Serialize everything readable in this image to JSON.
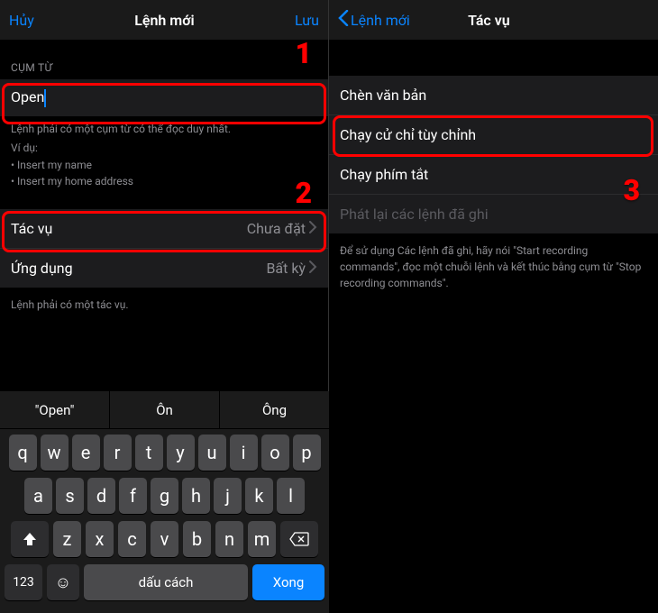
{
  "left": {
    "nav": {
      "cancel": "Hủy",
      "title": "Lệnh mới",
      "save": "Lưu"
    },
    "section_phrase": "CỤM TỪ",
    "input_value": "Open",
    "help_line": "Lệnh phải có một cụm từ có thể đọc duy nhất.",
    "help_example_label": "Ví dụ:",
    "help_examples": [
      "Insert my name",
      "Insert my home address"
    ],
    "rows": {
      "action": {
        "label": "Tác vụ",
        "value": "Chưa đặt"
      },
      "app": {
        "label": "Ứng dụng",
        "value": "Bất kỳ"
      }
    },
    "footer": "Lệnh phải có một tác vụ.",
    "annot": {
      "one": "1",
      "two": "2"
    },
    "keyboard": {
      "suggestions": [
        "\"Open\"",
        "Ôn",
        "Ông"
      ],
      "row1": [
        "q",
        "w",
        "e",
        "r",
        "t",
        "y",
        "u",
        "i",
        "o",
        "p"
      ],
      "row2": [
        "a",
        "s",
        "d",
        "f",
        "g",
        "h",
        "j",
        "k",
        "l"
      ],
      "row3": [
        "z",
        "x",
        "c",
        "v",
        "b",
        "n",
        "m"
      ],
      "num_key": "123",
      "space": "dấu cách",
      "return": "Xong"
    }
  },
  "right": {
    "nav": {
      "back": "Lệnh mới",
      "title": "Tác vụ"
    },
    "items": {
      "insert_text": "Chèn văn bản",
      "custom_gesture": "Chạy cử chỉ tùy chỉnh",
      "run_shortcut": "Chạy phím tắt",
      "playback": "Phát lại các lệnh đã ghi"
    },
    "footer": "Để sử dụng Các lệnh đã ghi, hãy nói \"Start recording commands\", đọc một chuỗi lệnh và kết thúc bằng cụm từ \"Stop recording commands\".",
    "annot": {
      "three": "3"
    }
  }
}
